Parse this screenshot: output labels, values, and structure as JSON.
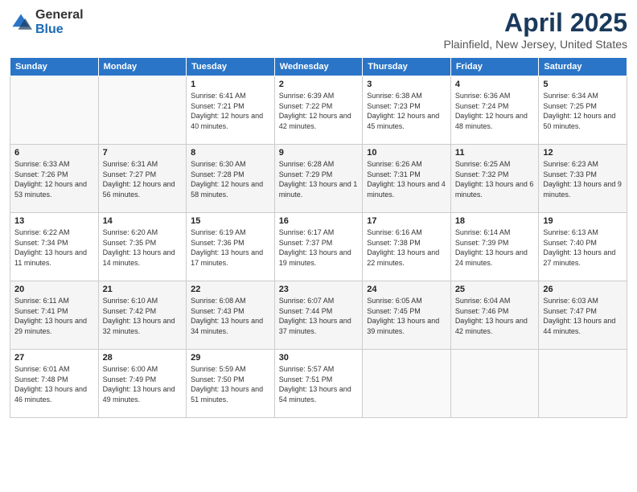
{
  "header": {
    "logo_general": "General",
    "logo_blue": "Blue",
    "month": "April 2025",
    "location": "Plainfield, New Jersey, United States"
  },
  "weekdays": [
    "Sunday",
    "Monday",
    "Tuesday",
    "Wednesday",
    "Thursday",
    "Friday",
    "Saturday"
  ],
  "weeks": [
    [
      {
        "day": "",
        "sunrise": "",
        "sunset": "",
        "daylight": ""
      },
      {
        "day": "",
        "sunrise": "",
        "sunset": "",
        "daylight": ""
      },
      {
        "day": "1",
        "sunrise": "Sunrise: 6:41 AM",
        "sunset": "Sunset: 7:21 PM",
        "daylight": "Daylight: 12 hours and 40 minutes."
      },
      {
        "day": "2",
        "sunrise": "Sunrise: 6:39 AM",
        "sunset": "Sunset: 7:22 PM",
        "daylight": "Daylight: 12 hours and 42 minutes."
      },
      {
        "day": "3",
        "sunrise": "Sunrise: 6:38 AM",
        "sunset": "Sunset: 7:23 PM",
        "daylight": "Daylight: 12 hours and 45 minutes."
      },
      {
        "day": "4",
        "sunrise": "Sunrise: 6:36 AM",
        "sunset": "Sunset: 7:24 PM",
        "daylight": "Daylight: 12 hours and 48 minutes."
      },
      {
        "day": "5",
        "sunrise": "Sunrise: 6:34 AM",
        "sunset": "Sunset: 7:25 PM",
        "daylight": "Daylight: 12 hours and 50 minutes."
      }
    ],
    [
      {
        "day": "6",
        "sunrise": "Sunrise: 6:33 AM",
        "sunset": "Sunset: 7:26 PM",
        "daylight": "Daylight: 12 hours and 53 minutes."
      },
      {
        "day": "7",
        "sunrise": "Sunrise: 6:31 AM",
        "sunset": "Sunset: 7:27 PM",
        "daylight": "Daylight: 12 hours and 56 minutes."
      },
      {
        "day": "8",
        "sunrise": "Sunrise: 6:30 AM",
        "sunset": "Sunset: 7:28 PM",
        "daylight": "Daylight: 12 hours and 58 minutes."
      },
      {
        "day": "9",
        "sunrise": "Sunrise: 6:28 AM",
        "sunset": "Sunset: 7:29 PM",
        "daylight": "Daylight: 13 hours and 1 minute."
      },
      {
        "day": "10",
        "sunrise": "Sunrise: 6:26 AM",
        "sunset": "Sunset: 7:31 PM",
        "daylight": "Daylight: 13 hours and 4 minutes."
      },
      {
        "day": "11",
        "sunrise": "Sunrise: 6:25 AM",
        "sunset": "Sunset: 7:32 PM",
        "daylight": "Daylight: 13 hours and 6 minutes."
      },
      {
        "day": "12",
        "sunrise": "Sunrise: 6:23 AM",
        "sunset": "Sunset: 7:33 PM",
        "daylight": "Daylight: 13 hours and 9 minutes."
      }
    ],
    [
      {
        "day": "13",
        "sunrise": "Sunrise: 6:22 AM",
        "sunset": "Sunset: 7:34 PM",
        "daylight": "Daylight: 13 hours and 11 minutes."
      },
      {
        "day": "14",
        "sunrise": "Sunrise: 6:20 AM",
        "sunset": "Sunset: 7:35 PM",
        "daylight": "Daylight: 13 hours and 14 minutes."
      },
      {
        "day": "15",
        "sunrise": "Sunrise: 6:19 AM",
        "sunset": "Sunset: 7:36 PM",
        "daylight": "Daylight: 13 hours and 17 minutes."
      },
      {
        "day": "16",
        "sunrise": "Sunrise: 6:17 AM",
        "sunset": "Sunset: 7:37 PM",
        "daylight": "Daylight: 13 hours and 19 minutes."
      },
      {
        "day": "17",
        "sunrise": "Sunrise: 6:16 AM",
        "sunset": "Sunset: 7:38 PM",
        "daylight": "Daylight: 13 hours and 22 minutes."
      },
      {
        "day": "18",
        "sunrise": "Sunrise: 6:14 AM",
        "sunset": "Sunset: 7:39 PM",
        "daylight": "Daylight: 13 hours and 24 minutes."
      },
      {
        "day": "19",
        "sunrise": "Sunrise: 6:13 AM",
        "sunset": "Sunset: 7:40 PM",
        "daylight": "Daylight: 13 hours and 27 minutes."
      }
    ],
    [
      {
        "day": "20",
        "sunrise": "Sunrise: 6:11 AM",
        "sunset": "Sunset: 7:41 PM",
        "daylight": "Daylight: 13 hours and 29 minutes."
      },
      {
        "day": "21",
        "sunrise": "Sunrise: 6:10 AM",
        "sunset": "Sunset: 7:42 PM",
        "daylight": "Daylight: 13 hours and 32 minutes."
      },
      {
        "day": "22",
        "sunrise": "Sunrise: 6:08 AM",
        "sunset": "Sunset: 7:43 PM",
        "daylight": "Daylight: 13 hours and 34 minutes."
      },
      {
        "day": "23",
        "sunrise": "Sunrise: 6:07 AM",
        "sunset": "Sunset: 7:44 PM",
        "daylight": "Daylight: 13 hours and 37 minutes."
      },
      {
        "day": "24",
        "sunrise": "Sunrise: 6:05 AM",
        "sunset": "Sunset: 7:45 PM",
        "daylight": "Daylight: 13 hours and 39 minutes."
      },
      {
        "day": "25",
        "sunrise": "Sunrise: 6:04 AM",
        "sunset": "Sunset: 7:46 PM",
        "daylight": "Daylight: 13 hours and 42 minutes."
      },
      {
        "day": "26",
        "sunrise": "Sunrise: 6:03 AM",
        "sunset": "Sunset: 7:47 PM",
        "daylight": "Daylight: 13 hours and 44 minutes."
      }
    ],
    [
      {
        "day": "27",
        "sunrise": "Sunrise: 6:01 AM",
        "sunset": "Sunset: 7:48 PM",
        "daylight": "Daylight: 13 hours and 46 minutes."
      },
      {
        "day": "28",
        "sunrise": "Sunrise: 6:00 AM",
        "sunset": "Sunset: 7:49 PM",
        "daylight": "Daylight: 13 hours and 49 minutes."
      },
      {
        "day": "29",
        "sunrise": "Sunrise: 5:59 AM",
        "sunset": "Sunset: 7:50 PM",
        "daylight": "Daylight: 13 hours and 51 minutes."
      },
      {
        "day": "30",
        "sunrise": "Sunrise: 5:57 AM",
        "sunset": "Sunset: 7:51 PM",
        "daylight": "Daylight: 13 hours and 54 minutes."
      },
      {
        "day": "",
        "sunrise": "",
        "sunset": "",
        "daylight": ""
      },
      {
        "day": "",
        "sunrise": "",
        "sunset": "",
        "daylight": ""
      },
      {
        "day": "",
        "sunrise": "",
        "sunset": "",
        "daylight": ""
      }
    ]
  ]
}
